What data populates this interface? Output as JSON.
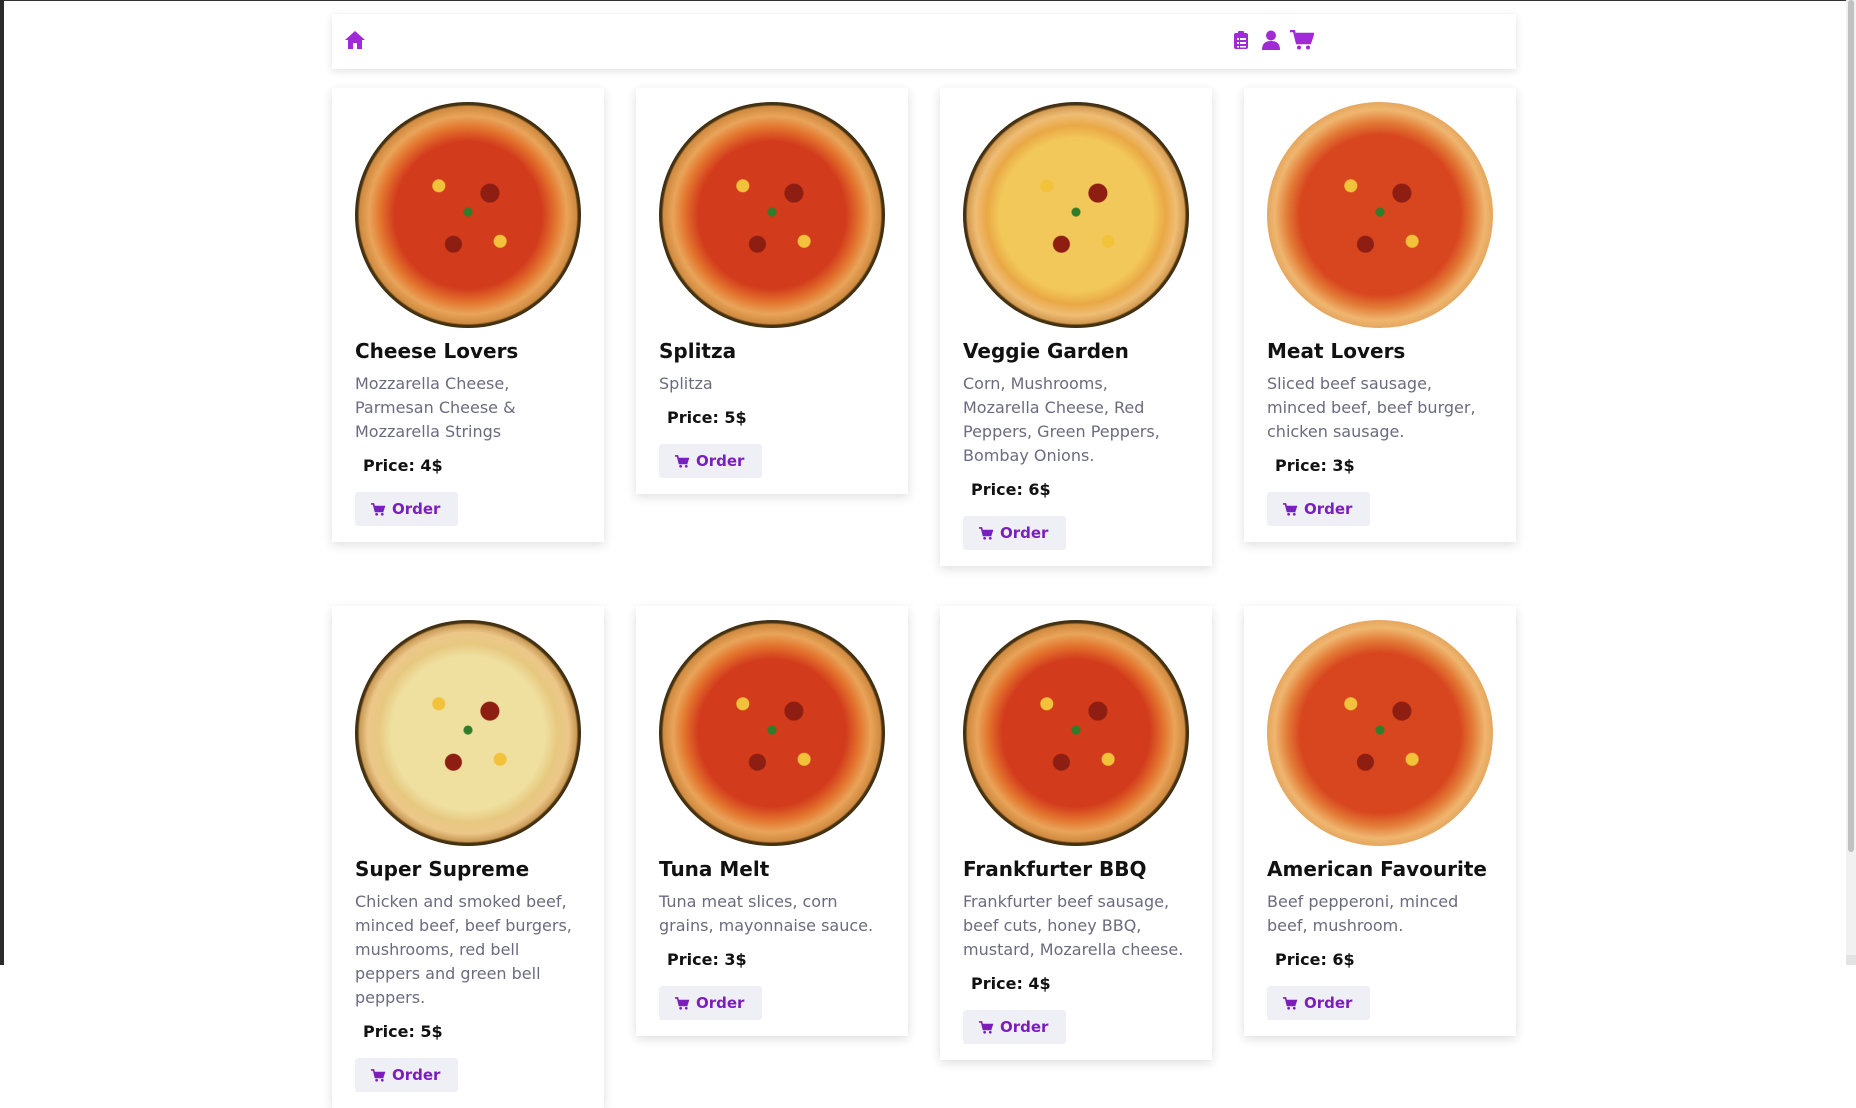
{
  "navbar": {
    "home_icon": "home-icon",
    "right_icons": [
      "clipboard-list-icon",
      "user-icon",
      "shopping-cart-icon"
    ],
    "accent_color": "#a02ad6"
  },
  "products": [
    {
      "name": "Cheese Lovers",
      "description": "Mozzarella Cheese, Parmesan Cheese & Mozzarella Strings",
      "price": "Price: 4$",
      "button": "Order"
    },
    {
      "name": "Splitza",
      "description": "Splitza",
      "price": "Price: 5$",
      "button": "Order"
    },
    {
      "name": "Veggie Garden",
      "description": "Corn, Mushrooms, Mozarella Cheese, Red Peppers, Green Peppers, Bombay Onions.",
      "price": "Price: 6$",
      "button": "Order"
    },
    {
      "name": "Meat Lovers",
      "description": "Sliced beef sausage, minced beef, beef burger, chicken sausage.",
      "price": "Price: 3$",
      "button": "Order"
    },
    {
      "name": "Super Supreme",
      "description": "Chicken and smoked beef, minced beef, beef burgers, mushrooms, red bell peppers and green bell peppers.",
      "price": "Price: 5$",
      "button": "Order"
    },
    {
      "name": "Tuna Melt",
      "description": "Tuna meat slices, corn grains, mayonnaise sauce.",
      "price": "Price: 3$",
      "button": "Order"
    },
    {
      "name": "Frankfurter BBQ",
      "description": "Frankfurter beef sausage, beef cuts, honey BBQ, mustard, Mozarella cheese.",
      "price": "Price: 4$",
      "button": "Order"
    },
    {
      "name": "American Favourite",
      "description": "Beef pepperoni, minced beef, mushroom.",
      "price": "Price: 6$",
      "button": "Order"
    }
  ]
}
